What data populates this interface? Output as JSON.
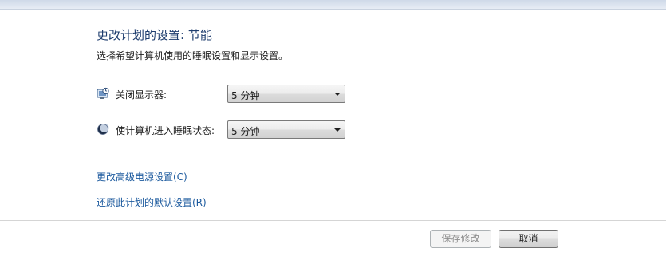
{
  "header": {
    "title": "更改计划的设置: 节能",
    "subtitle": "选择希望计算机使用的睡眠设置和显示设置。"
  },
  "settings": {
    "display_off": {
      "icon": "monitor-clock-icon",
      "label": "关闭显示器:",
      "value": "5 分钟"
    },
    "sleep": {
      "icon": "moon-icon",
      "label": "使计算机进入睡眠状态:",
      "value": "5 分钟"
    }
  },
  "links": {
    "advanced_power": "更改高级电源设置(C)",
    "restore_defaults": "还原此计划的默认设置(R)"
  },
  "buttons": {
    "save": "保存修改",
    "cancel": "取消"
  },
  "colors": {
    "title": "#1e3d6e",
    "link": "#1c5a9e",
    "disabled_text": "#8d8d8d"
  }
}
